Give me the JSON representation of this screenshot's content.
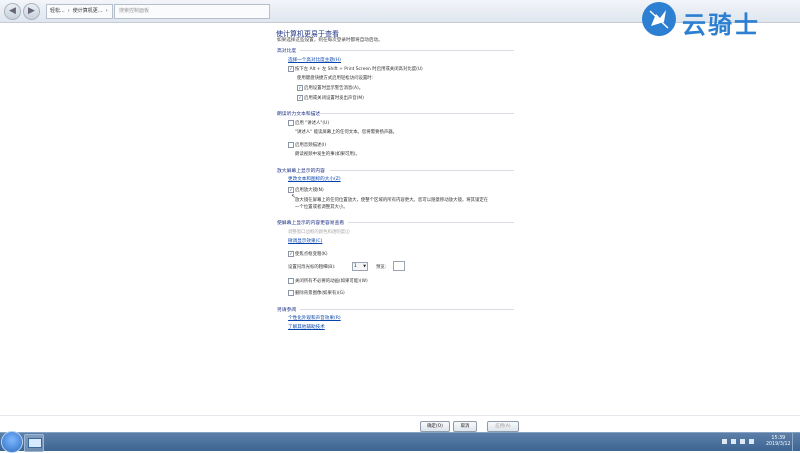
{
  "toolbar": {
    "breadcrumbs": [
      "轻松...",
      "›",
      "使计算机更...",
      "›"
    ],
    "search_placeholder": "搜索控制面板"
  },
  "logo": {
    "text": "云骑士",
    "color": "#2c7fd1"
  },
  "page": {
    "title": "使计算机更易于查看",
    "subtitle": "如果选择这些设置，则在每次登录时都将自动启动。"
  },
  "high_contrast": {
    "heading": "高对比度",
    "link": "选择一个高对比度主题(H)",
    "toggle_label": "按下左 Alt + 左 Shift + Print Screen 时启用或关闭高对比度(U)",
    "sub_heading": "使用键盘快捷方式启用轻松访问设置时:",
    "warn_label": "启用设置时显示警告消息(A)。",
    "sound_label": "启用或关闭设置时发出声音(M)",
    "toggle_checked": true,
    "warn_checked": true,
    "sound_checked": true
  },
  "narrator": {
    "heading": "朗读听力文本和描述",
    "narrator_label": "启用 \"讲述人\"(U)",
    "narrator_desc": "\"讲述人\" 能读屏幕上的任何文本。您将需要扬声器。",
    "audio_desc_label": "启用音频描述(I)",
    "audio_desc_desc": "朗读视频中发生的事(如果可用)。",
    "narrator_checked": false,
    "audio_desc_checked": false
  },
  "magnify": {
    "heading": "放大屏幕上显示的内容",
    "link": "更改文本和图标的大小(Z)",
    "magnifier_label": "启用放大镜(N)",
    "magnifier_desc_1": "放大镜在屏幕上的任何位置放大，使整个区域的所有内容更大。您可以随意移动放大镜，将其锁定在",
    "magnifier_desc_2": "一个位置或者调整其大小。",
    "magnifier_checked": true
  },
  "visibility": {
    "heading": "使屏幕上显示的内容更容易查看",
    "border_link": "调整窗口边框的颜色和透明度(J)",
    "display_link": "微调显示效果(C)",
    "focus_label": "使焦点框变粗(K)",
    "focus_checked": true,
    "cursor_label": "设置闪烁光标的粗细(B):",
    "cursor_value": "1",
    "preview_label": "预览:",
    "animation_label": "关闭所有不必要的动画(如果可能)(W)",
    "animation_checked": false,
    "background_label": "删除背景图像(如果有)(G)",
    "background_checked": false
  },
  "related": {
    "heading": "另请参阅",
    "link_1": "个性化外观和声音效果(R)",
    "link_2": "了解其他辅助技术"
  },
  "buttons": {
    "ok": "确定(O)",
    "cancel": "取消",
    "apply": "应用(A)"
  },
  "taskbar": {
    "time": "15:39",
    "date": "2019/3/12"
  }
}
